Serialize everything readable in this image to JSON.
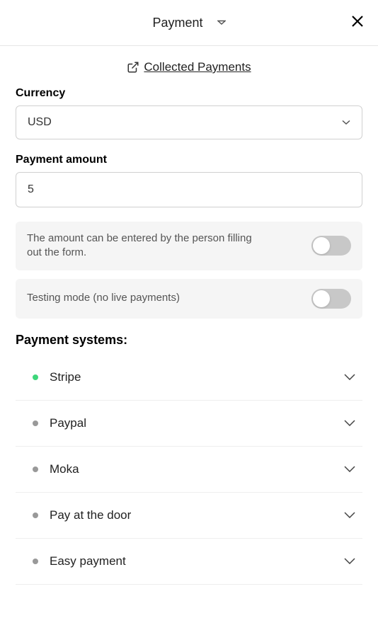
{
  "header": {
    "title": "Payment"
  },
  "collected_link": " Collected Payments",
  "currency": {
    "label": "Currency",
    "value": "USD"
  },
  "amount": {
    "label": "Payment amount",
    "value": "5"
  },
  "toggles": {
    "user_amount": "The amount can be entered by the person filling out the form.",
    "testing": "Testing mode (no live payments)"
  },
  "systems_title": "Payment systems:",
  "systems": [
    {
      "name": "Stripe",
      "active": true
    },
    {
      "name": "Paypal",
      "active": false
    },
    {
      "name": "Moka",
      "active": false
    },
    {
      "name": "Pay at the door",
      "active": false
    },
    {
      "name": "Easy payment",
      "active": false
    }
  ]
}
